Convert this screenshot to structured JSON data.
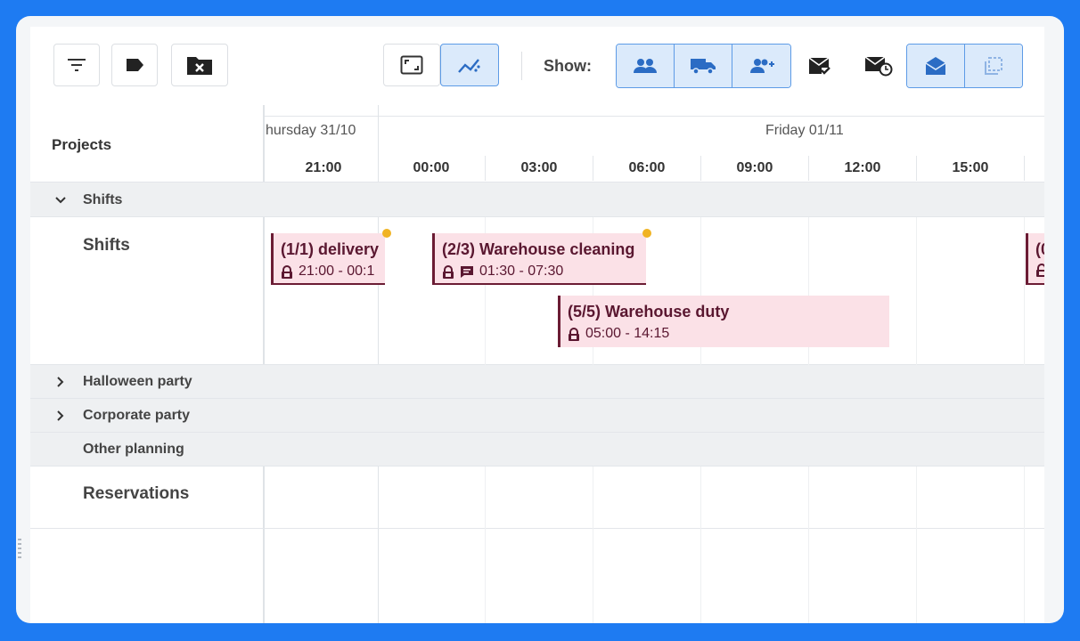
{
  "toolbar": {
    "show_label": "Show:",
    "left_icons": [
      "filter-icon",
      "tag-icon",
      "folder-close-icon"
    ],
    "view_icons": [
      "fit-screen-icon",
      "trend-icon"
    ],
    "show_icons": [
      "people-icon",
      "truck-icon",
      "person-add-icon",
      "mail-check-icon",
      "mail-clock-icon",
      "mail-open-icon",
      "layers-icon"
    ]
  },
  "timeline": {
    "projects_label": "Projects",
    "days": [
      "hursday 31/10",
      "Friday 01/11"
    ],
    "hours": [
      "21:00",
      "00:00",
      "03:00",
      "06:00",
      "09:00",
      "12:00",
      "15:00"
    ]
  },
  "rows": {
    "shifts_group": "Shifts",
    "shifts": "Shifts",
    "halloween": "Halloween party",
    "corporate": "Corporate party",
    "other": "Other planning",
    "reservations": "Reservations"
  },
  "shifts": [
    {
      "title": "(1/1) delivery",
      "time": "21:00 - 00:1"
    },
    {
      "title": "(2/3) Warehouse cleaning",
      "time": "01:30 - 07:30"
    },
    {
      "title": "(5/5) Warehouse duty",
      "time": "05:00 - 14:15"
    },
    {
      "title": "(0",
      "time": ""
    }
  ],
  "colors": {
    "frame": "#1e7bf2",
    "active_toggle": "#dbeafb",
    "shift_bg": "#fbe1e7",
    "shift_border": "#6b1c34",
    "indicator_dot": "#f0b323"
  }
}
